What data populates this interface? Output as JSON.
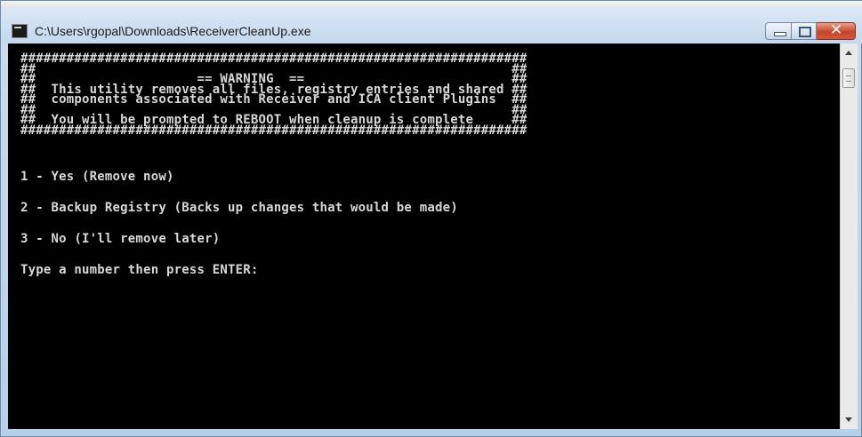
{
  "window": {
    "title": "C:\\Users\\rgopal\\Downloads\\ReceiverCleanUp.exe",
    "close_glyph": "✕"
  },
  "icons": {
    "app": "console-app-icon",
    "minimize": "minimize-icon",
    "maximize": "maximize-icon",
    "close": "close-icon"
  },
  "console": {
    "banner": [
      "##################################################################",
      "##                                                              ##",
      "##                     == WARNING  ==                           ##",
      "##  This utility removes all files, registry entries and shared ##",
      "##  components associated with Receiver and ICA client Plugins  ##",
      "##                                                              ##",
      "##  You will be prompted to REBOOT when cleanup is complete     ##",
      "##################################################################"
    ],
    "options": [
      "1 - Yes (Remove now)",
      "2 - Backup Registry (Backs up changes that would be made)",
      "3 - No (I'll remove later)"
    ],
    "prompt": "Type a number then press ENTER:"
  },
  "colors": {
    "console_bg": "#000000",
    "console_text": "#d8d8d8",
    "close_button": "#c7442a"
  }
}
